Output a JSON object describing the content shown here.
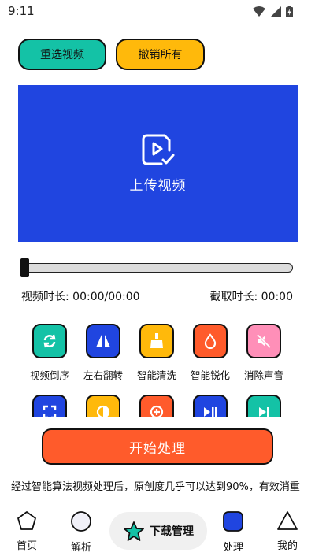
{
  "status_bar": {
    "time": "9:11",
    "icons": [
      "wifi-icon",
      "signal-icon",
      "battery-icon"
    ]
  },
  "top_buttons": {
    "reselect": "重选视频",
    "undo_all": "撤销所有"
  },
  "upload": {
    "label": "上传视频",
    "icon": "video-upload-icon"
  },
  "slider": {
    "value": 0
  },
  "time_info": {
    "duration": "视频时长: 00:00/00:00",
    "clip": "截取时长: 00:00"
  },
  "tools": [
    {
      "label": "视频倒序",
      "color": "#14c2a6",
      "icon": "reverse-icon"
    },
    {
      "label": "左右翻转",
      "color": "#2045e0",
      "icon": "flip-icon"
    },
    {
      "label": "智能清洗",
      "color": "#ffb90b",
      "icon": "broom-icon"
    },
    {
      "label": "智能锐化",
      "color": "#ff5b2b",
      "icon": "drop-icon"
    },
    {
      "label": "消除声音",
      "color": "#ff8fb8",
      "icon": "mute-icon"
    },
    {
      "label": "",
      "color": "#2045e0",
      "icon": "crop-icon"
    },
    {
      "label": "",
      "color": "#ffb90b",
      "icon": "contrast-icon"
    },
    {
      "label": "",
      "color": "#ff5b2b",
      "icon": "zoom-icon"
    },
    {
      "label": "",
      "color": "#2045e0",
      "icon": "play-pause-icon"
    },
    {
      "label": "",
      "color": "#14c2a6",
      "icon": "skip-icon"
    }
  ],
  "start_button": "开始处理",
  "description": "经过智能算法视频处理后，原创度几乎可以达到90%，有效消重",
  "bottom_nav": {
    "home": "首页",
    "parse": "解析",
    "download": "下载管理",
    "process": "处理",
    "mine": "我的"
  },
  "colors": {
    "teal": "#14c2a6",
    "amber": "#ffb90b",
    "blue": "#2045e0",
    "orange": "#ff5b2b",
    "pink": "#ff8fb8"
  }
}
